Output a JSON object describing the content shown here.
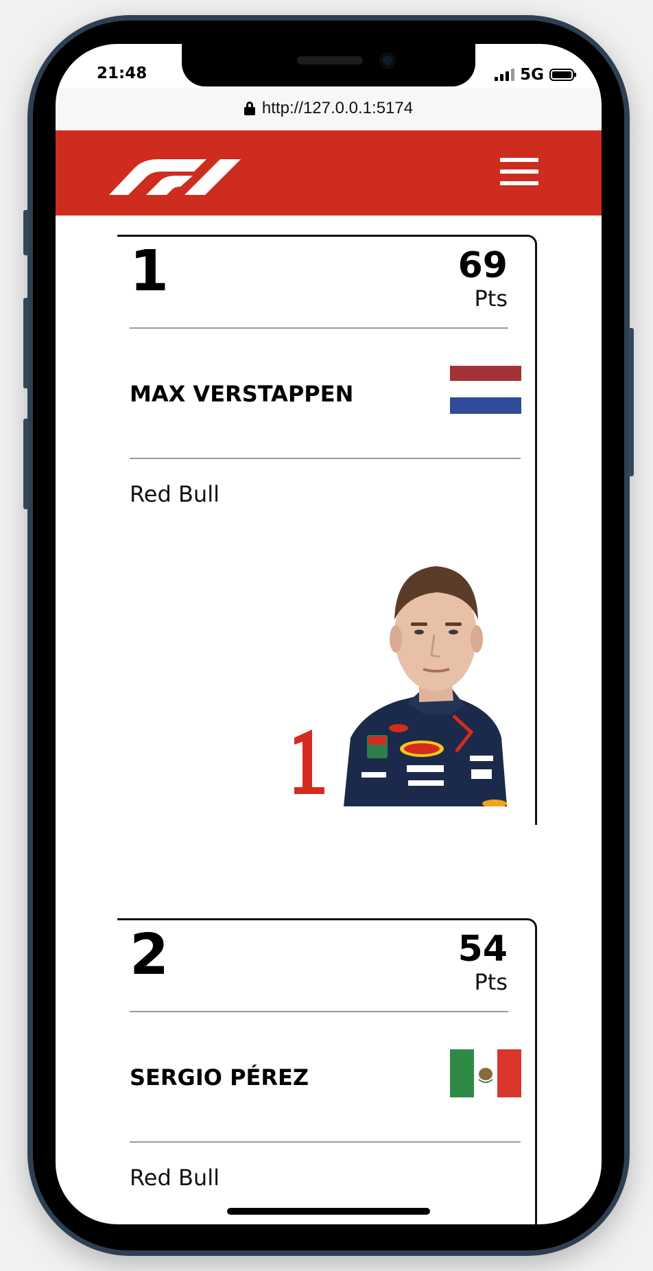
{
  "status": {
    "time": "21:48",
    "network": "5G"
  },
  "browser": {
    "url": "http://127.0.0.1:5174"
  },
  "header": {
    "logo": "f1-logo",
    "menu_icon": "hamburger-menu-icon"
  },
  "drivers": [
    {
      "position": "1",
      "points": "69",
      "points_label": "Pts",
      "name": "MAX VERSTAPPEN",
      "team": "Red Bull",
      "flag": "netherlands-flag",
      "car_number": "1",
      "car_number_color": "#d52b1e"
    },
    {
      "position": "2",
      "points": "54",
      "points_label": "Pts",
      "name": "SERGIO PÉREZ",
      "team": "Red Bull",
      "flag": "mexico-flag"
    }
  ],
  "colors": {
    "brand_red": "#cd2c1e",
    "navy": "#1b2a4a"
  }
}
